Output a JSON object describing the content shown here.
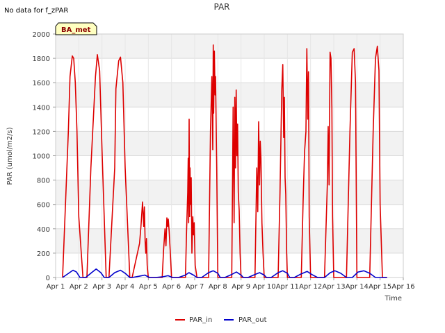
{
  "chart_data": {
    "type": "line",
    "title": "PAR",
    "no_data_note": "No data for f_zPAR",
    "site_badge": "BA_met",
    "xlabel": "Time",
    "ylabel": "PAR (umol/m2/s)",
    "ylim": [
      0,
      2000
    ],
    "yticks": [
      0,
      200,
      400,
      600,
      800,
      1000,
      1200,
      1400,
      1600,
      1800,
      2000
    ],
    "xlim": [
      1,
      16
    ],
    "xticks": [
      {
        "v": 1,
        "label": "Apr 1"
      },
      {
        "v": 2,
        "label": "Apr 2"
      },
      {
        "v": 3,
        "label": "Apr 3"
      },
      {
        "v": 4,
        "label": "Apr 4"
      },
      {
        "v": 5,
        "label": "Apr 5"
      },
      {
        "v": 6,
        "label": "Apr 6"
      },
      {
        "v": 7,
        "label": "Apr 7"
      },
      {
        "v": 8,
        "label": "Apr 8"
      },
      {
        "v": 9,
        "label": "Apr 9"
      },
      {
        "v": 10,
        "label": "Apr 10"
      },
      {
        "v": 11,
        "label": "Apr 11"
      },
      {
        "v": 12,
        "label": "Apr 12"
      },
      {
        "v": 13,
        "label": "Apr 13"
      },
      {
        "v": 14,
        "label": "Apr 14"
      },
      {
        "v": 15,
        "label": "Apr 15"
      },
      {
        "v": 16,
        "label": "Apr 16"
      }
    ],
    "grid": true,
    "legend_position": "bottom-center",
    "series": [
      {
        "name": "PAR_in",
        "color": "#dd0000",
        "x": [
          1.3,
          1.55,
          1.62,
          1.72,
          1.78,
          1.85,
          1.92,
          2.0,
          2.18,
          2.35,
          2.52,
          2.72,
          2.8,
          2.9,
          3.0,
          3.18,
          3.3,
          3.55,
          3.6,
          3.72,
          3.8,
          3.9,
          4.0,
          4.2,
          4.3,
          4.62,
          4.68,
          4.75,
          4.8,
          4.83,
          4.86,
          4.89,
          4.92,
          4.95,
          5.0,
          5.05,
          5.1,
          5.3,
          5.6,
          5.66,
          5.72,
          5.76,
          5.8,
          5.83,
          5.86,
          5.9,
          5.95,
          6.0,
          6.1,
          6.3,
          6.6,
          6.65,
          6.7,
          6.72,
          6.74,
          6.76,
          6.78,
          6.8,
          6.82,
          6.85,
          6.88,
          6.92,
          6.95,
          6.98,
          7.02,
          7.1,
          7.3,
          7.6,
          7.68,
          7.74,
          7.78,
          7.8,
          7.82,
          7.85,
          7.88,
          7.9,
          7.95,
          8.0,
          8.1,
          8.3,
          8.6,
          8.66,
          8.7,
          8.73,
          8.76,
          8.79,
          8.82,
          8.85,
          8.88,
          8.92,
          8.96,
          9.0,
          9.1,
          9.3,
          9.6,
          9.68,
          9.72,
          9.76,
          9.8,
          9.83,
          9.86,
          9.9,
          9.95,
          10.0,
          10.1,
          10.3,
          10.6,
          10.68,
          10.76,
          10.8,
          10.84,
          10.87,
          10.9,
          10.93,
          10.97,
          11.0,
          11.1,
          11.3,
          11.6,
          11.68,
          11.74,
          11.8,
          11.84,
          11.88,
          11.91,
          11.94,
          12.0,
          12.1,
          12.3,
          12.6,
          12.72,
          12.76,
          12.8,
          12.84,
          12.88,
          12.92,
          12.95,
          13.0,
          13.1,
          13.3,
          13.55,
          13.7,
          13.8,
          13.88,
          13.94,
          14.0,
          14.1,
          14.3,
          14.55,
          14.7,
          14.8,
          14.88,
          14.95,
          15.0,
          15.1,
          15.3
        ],
        "y": [
          0,
          1200,
          1650,
          1820,
          1800,
          1600,
          1200,
          500,
          0,
          0,
          900,
          1650,
          1830,
          1700,
          1050,
          0,
          0,
          900,
          1550,
          1780,
          1810,
          1600,
          900,
          0,
          0,
          280,
          420,
          620,
          420,
          580,
          300,
          200,
          320,
          100,
          0,
          0,
          0,
          0,
          0,
          230,
          400,
          260,
          490,
          420,
          480,
          380,
          200,
          0,
          0,
          0,
          0,
          380,
          700,
          980,
          450,
          1300,
          500,
          900,
          600,
          820,
          200,
          500,
          350,
          450,
          100,
          0,
          0,
          0,
          1200,
          1650,
          1050,
          1910,
          1350,
          1860,
          1500,
          1650,
          900,
          0,
          0,
          0,
          0,
          1400,
          450,
          1480,
          900,
          1540,
          1000,
          1260,
          700,
          550,
          200,
          0,
          0,
          0,
          0,
          900,
          540,
          1280,
          760,
          1120,
          980,
          450,
          200,
          0,
          0,
          0,
          0,
          700,
          1550,
          1750,
          1150,
          1480,
          820,
          680,
          200,
          0,
          0,
          0,
          0,
          640,
          1030,
          1200,
          1880,
          1300,
          1690,
          500,
          0,
          0,
          0,
          0,
          750,
          1240,
          760,
          1850,
          1800,
          1400,
          500,
          0,
          0,
          0,
          0,
          1200,
          1850,
          1880,
          1600,
          0,
          0,
          0,
          0,
          1200,
          1800,
          1900,
          1700,
          600,
          0,
          0
        ]
      },
      {
        "name": "PAR_out",
        "color": "#0000cc",
        "x": [
          1.3,
          1.6,
          1.75,
          1.9,
          2.05,
          2.3,
          2.55,
          2.75,
          2.95,
          3.1,
          3.3,
          3.55,
          3.8,
          4.0,
          4.2,
          4.3,
          4.6,
          4.85,
          5.05,
          5.3,
          5.6,
          5.85,
          6.05,
          6.3,
          6.6,
          6.75,
          6.95,
          7.1,
          7.3,
          7.6,
          7.8,
          8.0,
          8.1,
          8.3,
          8.6,
          8.8,
          9.0,
          9.1,
          9.3,
          9.6,
          9.8,
          10.0,
          10.1,
          10.3,
          10.6,
          10.8,
          11.0,
          11.1,
          11.3,
          11.6,
          11.85,
          12.05,
          12.3,
          12.6,
          12.85,
          13.05,
          13.3,
          13.55,
          13.8,
          14.05,
          14.3,
          14.55,
          14.8,
          15.05,
          15.3
        ],
        "y": [
          0,
          40,
          60,
          45,
          0,
          0,
          40,
          70,
          40,
          0,
          0,
          40,
          60,
          35,
          0,
          0,
          10,
          20,
          0,
          0,
          5,
          15,
          0,
          0,
          20,
          40,
          20,
          0,
          0,
          40,
          55,
          35,
          0,
          0,
          25,
          45,
          20,
          0,
          0,
          25,
          40,
          20,
          0,
          0,
          40,
          55,
          35,
          0,
          0,
          30,
          50,
          25,
          0,
          0,
          40,
          55,
          35,
          0,
          0,
          45,
          55,
          35,
          0,
          0,
          0
        ]
      }
    ]
  }
}
